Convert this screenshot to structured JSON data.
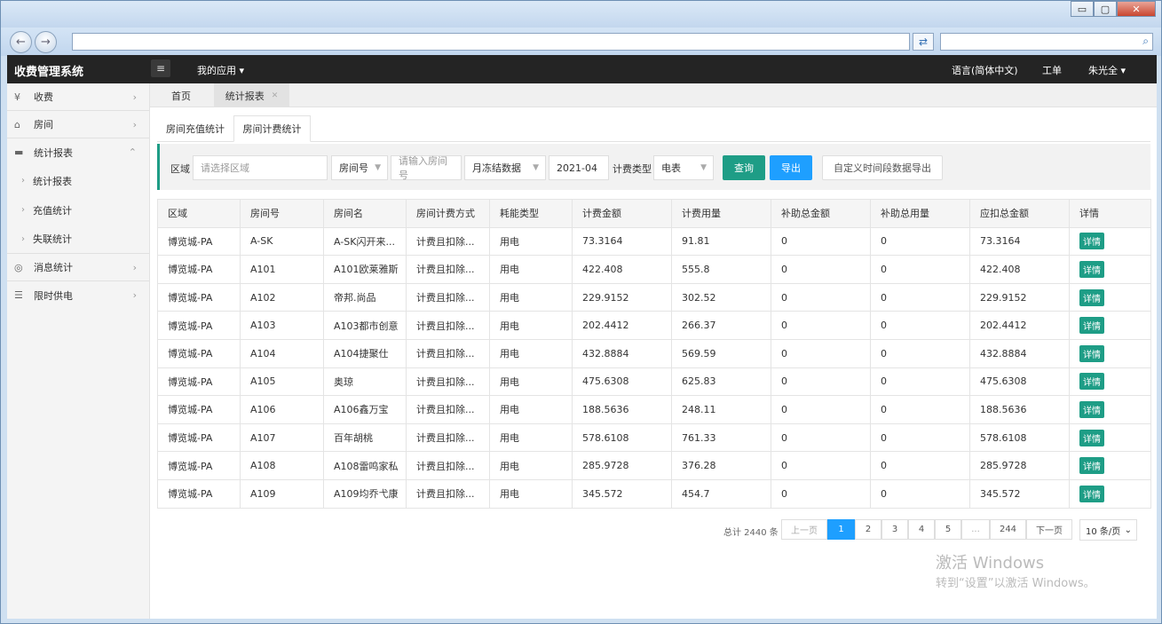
{
  "window": {
    "minimize": "▭",
    "restore": "▢",
    "close": "✕"
  },
  "app": {
    "title": "收费管理系统",
    "my_apps": "我的应用",
    "language": "语言(简体中文)",
    "ticket": "工单",
    "user": "朱光全"
  },
  "sidebar": {
    "items": [
      {
        "label": "收费",
        "icon": "yen-icon",
        "glyph": "¥"
      },
      {
        "label": "房间",
        "icon": "home-icon",
        "glyph": "⌂"
      },
      {
        "label": "统计报表",
        "icon": "report-icon",
        "glyph": "▬"
      },
      {
        "label": "消息统计",
        "icon": "message-icon",
        "glyph": "◎"
      },
      {
        "label": "限时供电",
        "icon": "sliders-icon",
        "glyph": "☰"
      }
    ],
    "sub_items": [
      "统计报表",
      "充值统计",
      "失联统计"
    ]
  },
  "page_tabs": {
    "home": "首页",
    "report": "统计报表",
    "close": "✕"
  },
  "sub_tabs": {
    "recharge": "房间充值统计",
    "billing": "房间计费统计"
  },
  "filters": {
    "area_label": "区域",
    "area_placeholder": "请选择区域",
    "room_select": "房间号",
    "room_placeholder": "请输入房间号",
    "data_type": "月冻结数据",
    "month": "2021-04",
    "bill_type_label": "计费类型",
    "bill_type": "电表",
    "query": "查询",
    "export": "导出",
    "custom_export": "自定义时间段数据导出"
  },
  "table": {
    "headers": [
      "区域",
      "房间号",
      "房间名",
      "房间计费方式",
      "耗能类型",
      "计费金额",
      "计费用量",
      "补助总金额",
      "补助总用量",
      "应扣总金额",
      "详情"
    ],
    "detail_label": "详情",
    "rows": [
      [
        "博览城-PA",
        "A-SK",
        "A-SK闪开来...",
        "计费且扣除...",
        "用电",
        "73.3164",
        "91.81",
        "0",
        "0",
        "73.3164"
      ],
      [
        "博览城-PA",
        "A101",
        "A101欧莱雅斯",
        "计费且扣除...",
        "用电",
        "422.408",
        "555.8",
        "0",
        "0",
        "422.408"
      ],
      [
        "博览城-PA",
        "A102",
        "帝邦.尚品",
        "计费且扣除...",
        "用电",
        "229.9152",
        "302.52",
        "0",
        "0",
        "229.9152"
      ],
      [
        "博览城-PA",
        "A103",
        "A103都市创意",
        "计费且扣除...",
        "用电",
        "202.4412",
        "266.37",
        "0",
        "0",
        "202.4412"
      ],
      [
        "博览城-PA",
        "A104",
        "A104捷聚仕",
        "计费且扣除...",
        "用电",
        "432.8884",
        "569.59",
        "0",
        "0",
        "432.8884"
      ],
      [
        "博览城-PA",
        "A105",
        "奥琼",
        "计费且扣除...",
        "用电",
        "475.6308",
        "625.83",
        "0",
        "0",
        "475.6308"
      ],
      [
        "博览城-PA",
        "A106",
        "A106鑫万宝",
        "计费且扣除...",
        "用电",
        "188.5636",
        "248.11",
        "0",
        "0",
        "188.5636"
      ],
      [
        "博览城-PA",
        "A107",
        "百年胡桃",
        "计费且扣除...",
        "用电",
        "578.6108",
        "761.33",
        "0",
        "0",
        "578.6108"
      ],
      [
        "博览城-PA",
        "A108",
        "A108雷鸣家私",
        "计费且扣除...",
        "用电",
        "285.9728",
        "376.28",
        "0",
        "0",
        "285.9728"
      ],
      [
        "博览城-PA",
        "A109",
        "A109均乔弋康",
        "计费且扣除...",
        "用电",
        "345.572",
        "454.7",
        "0",
        "0",
        "345.572"
      ]
    ]
  },
  "pagination": {
    "total": "总计 2440 条",
    "prev": "上一页",
    "pages": [
      "1",
      "2",
      "3",
      "4",
      "5",
      "...",
      "244"
    ],
    "current": "1",
    "next": "下一页",
    "page_size": "10 条/页"
  },
  "watermark": {
    "line1": "激活 Windows",
    "line2": "转到“设置”以激活 Windows。"
  },
  "colors": {
    "accent": "#1e9d86",
    "primary": "#1e9fff",
    "appbar": "#242424"
  }
}
